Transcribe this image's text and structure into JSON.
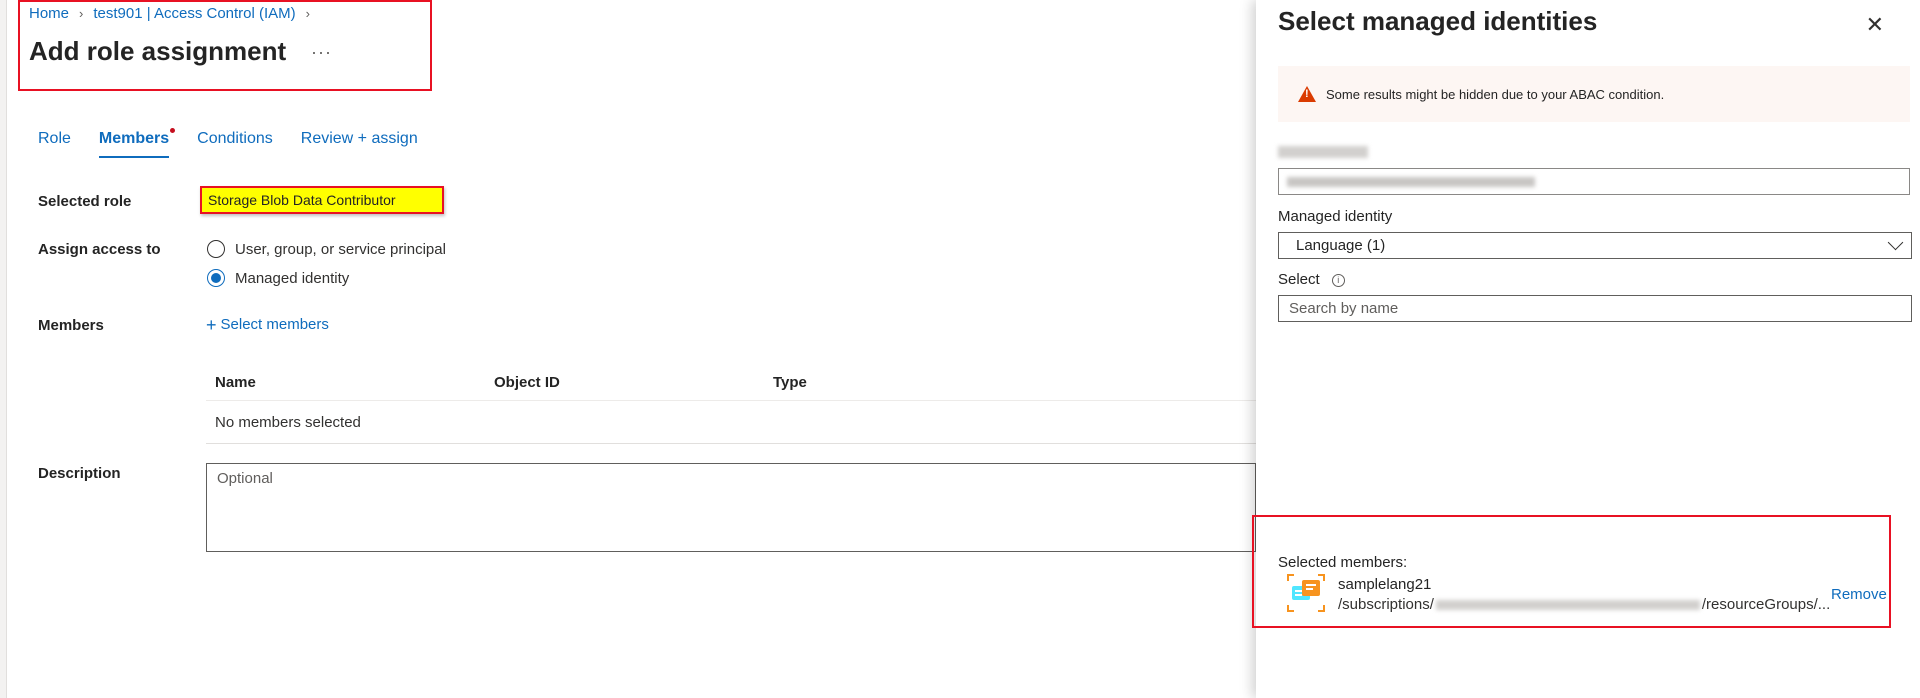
{
  "breadcrumb": {
    "home": "Home",
    "resource": "test901 | Access Control (IAM)"
  },
  "page": {
    "title": "Add role assignment",
    "more": "···"
  },
  "tabs": [
    {
      "label": "Role"
    },
    {
      "label": "Members"
    },
    {
      "label": "Conditions"
    },
    {
      "label": "Review + assign"
    }
  ],
  "form": {
    "selected_role_label": "Selected role",
    "selected_role_value": "Storage Blob Data Contributor",
    "assign_access_label": "Assign access to",
    "assign_options": [
      "User, group, or service principal",
      "Managed identity"
    ],
    "assign_selected": "Managed identity",
    "members_label": "Members",
    "select_members_link": "Select members",
    "table_headers": [
      "Name",
      "Object ID",
      "Type"
    ],
    "table_empty": "No members selected",
    "description_label": "Description",
    "description_placeholder": "Optional"
  },
  "panel": {
    "title": "Select managed identities",
    "warning": "Some results might be hidden due to your ABAC condition.",
    "managed_identity_label": "Managed identity",
    "managed_identity_value": "Language (1)",
    "select_label": "Select",
    "search_placeholder": "Search by name",
    "selected_members_label": "Selected members:",
    "member": {
      "name": "samplelang21",
      "path_prefix": "/subscriptions/",
      "path_suffix": "/resourceGroups/...",
      "remove_label": "Remove"
    }
  },
  "colors": {
    "accent": "#0f6cbd",
    "highlight_border": "#e81123",
    "role_highlight": "#ffff00",
    "warning": "#da3b01"
  }
}
